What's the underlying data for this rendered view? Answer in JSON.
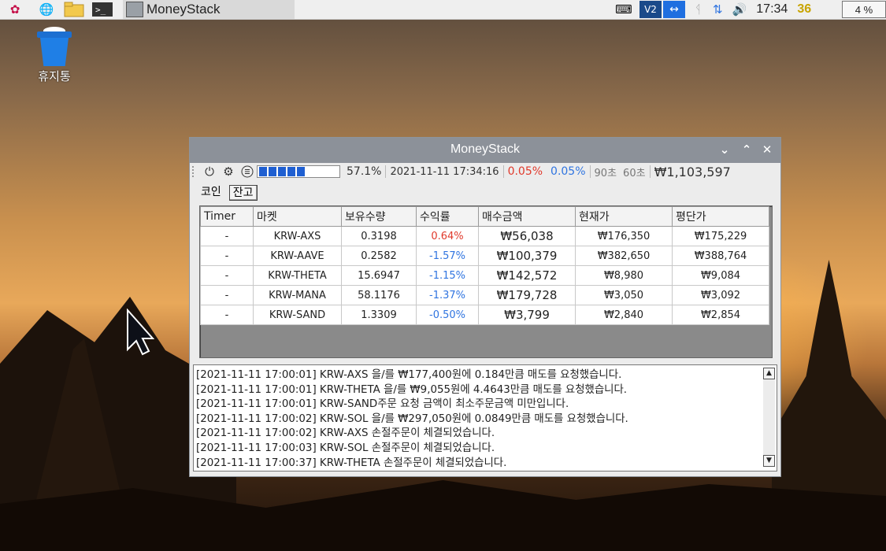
{
  "taskbar": {
    "icons": [
      "raspberry-icon",
      "globe-icon",
      "folder-icon",
      "terminal-icon"
    ],
    "active_task": "MoneyStack",
    "clock": "17:34",
    "temp": "36",
    "cpu": "4 %"
  },
  "desktop": {
    "trash_label": "휴지통"
  },
  "window": {
    "title": "MoneyStack",
    "toolbar": {
      "progress_percent": "57.1%",
      "progress_fraction": 0.571,
      "datetime": "2021-11-11 17:34:16",
      "rate_red": "0.05%",
      "rate_blue": "0.05%",
      "timer1": "90초",
      "timer2": "60초",
      "total": "₩1,103,597"
    },
    "tabs": [
      "코인",
      "잔고"
    ],
    "active_tab": "잔고",
    "table": {
      "headers": [
        "Timer",
        "마켓",
        "보유수량",
        "수익률",
        "매수금액",
        "현재가",
        "평단가"
      ],
      "rows": [
        {
          "timer": "-",
          "market": "KRW-AXS",
          "qty": "0.3198",
          "ret": "0.64%",
          "buy": "₩56,038",
          "cur": "₩176,350",
          "avg": "₩175,229"
        },
        {
          "timer": "-",
          "market": "KRW-AAVE",
          "qty": "0.2582",
          "ret": "-1.57%",
          "buy": "₩100,379",
          "cur": "₩382,650",
          "avg": "₩388,764"
        },
        {
          "timer": "-",
          "market": "KRW-THETA",
          "qty": "15.6947",
          "ret": "-1.15%",
          "buy": "₩142,572",
          "cur": "₩8,980",
          "avg": "₩9,084"
        },
        {
          "timer": "-",
          "market": "KRW-MANA",
          "qty": "58.1176",
          "ret": "-1.37%",
          "buy": "₩179,728",
          "cur": "₩3,050",
          "avg": "₩3,092"
        },
        {
          "timer": "-",
          "market": "KRW-SAND",
          "qty": "1.3309",
          "ret": "-0.50%",
          "buy": "₩3,799",
          "cur": "₩2,840",
          "avg": "₩2,854"
        }
      ]
    },
    "log": [
      "[2021-11-11 17:00:01] KRW-AXS 을/를 ₩177,400원에 0.184만큼 매도를 요청했습니다.",
      "[2021-11-11 17:00:01] KRW-THETA 을/를 ₩9,055원에 4.4643만큼 매도를 요청했습니다.",
      "[2021-11-11 17:00:01] KRW-SAND주문 요청 금액이 최소주문금액 미만입니다.",
      "[2021-11-11 17:00:02] KRW-SOL 을/를 ₩297,050원에 0.0849만큼 매도를 요청했습니다.",
      "[2021-11-11 17:00:02] KRW-AXS 손절주문이 체결되었습니다.",
      "[2021-11-11 17:00:03] KRW-SOL 손절주문이 체결되었습니다.",
      "[2021-11-11 17:00:37] KRW-THETA 손절주문이 체결되었습니다."
    ]
  }
}
